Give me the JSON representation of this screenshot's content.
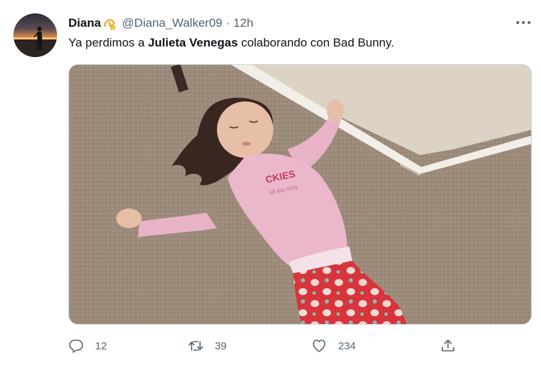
{
  "tweet": {
    "author": {
      "display_name": "Diana",
      "badge_emoji": "dizzy-star-icon",
      "handle": "@Diana_Walker09",
      "separator": "·",
      "time": "12h"
    },
    "text_parts": {
      "pre": "Ya perdimos a ",
      "bold": "Julieta Venegas",
      "post": " colaborando con Bad Bunny."
    },
    "media": {
      "shirt_text_line1": "CKIES",
      "shirt_text_line2": "all day long"
    },
    "actions": {
      "reply_count": "12",
      "retweet_count": "39",
      "like_count": "234"
    }
  },
  "colors": {
    "text_primary": "#0f1419",
    "text_secondary": "#536471",
    "border": "#cfd9de"
  }
}
